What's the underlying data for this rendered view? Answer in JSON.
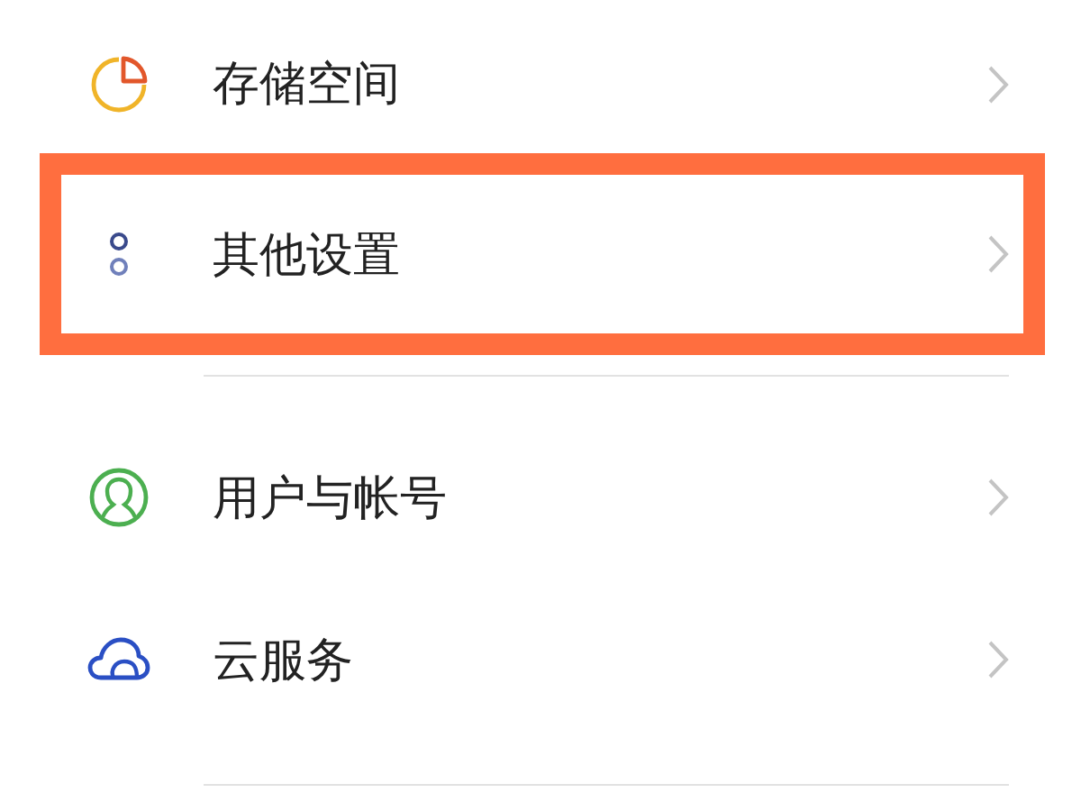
{
  "groups": [
    {
      "items": [
        {
          "kind": "storage",
          "label": "存储空间",
          "highlighted": false
        },
        {
          "kind": "other",
          "label": "其他设置",
          "highlighted": true
        }
      ]
    },
    {
      "items": [
        {
          "kind": "user",
          "label": "用户与帐号",
          "highlighted": false
        },
        {
          "kind": "cloud",
          "label": "云服务",
          "highlighted": false
        }
      ]
    }
  ]
}
